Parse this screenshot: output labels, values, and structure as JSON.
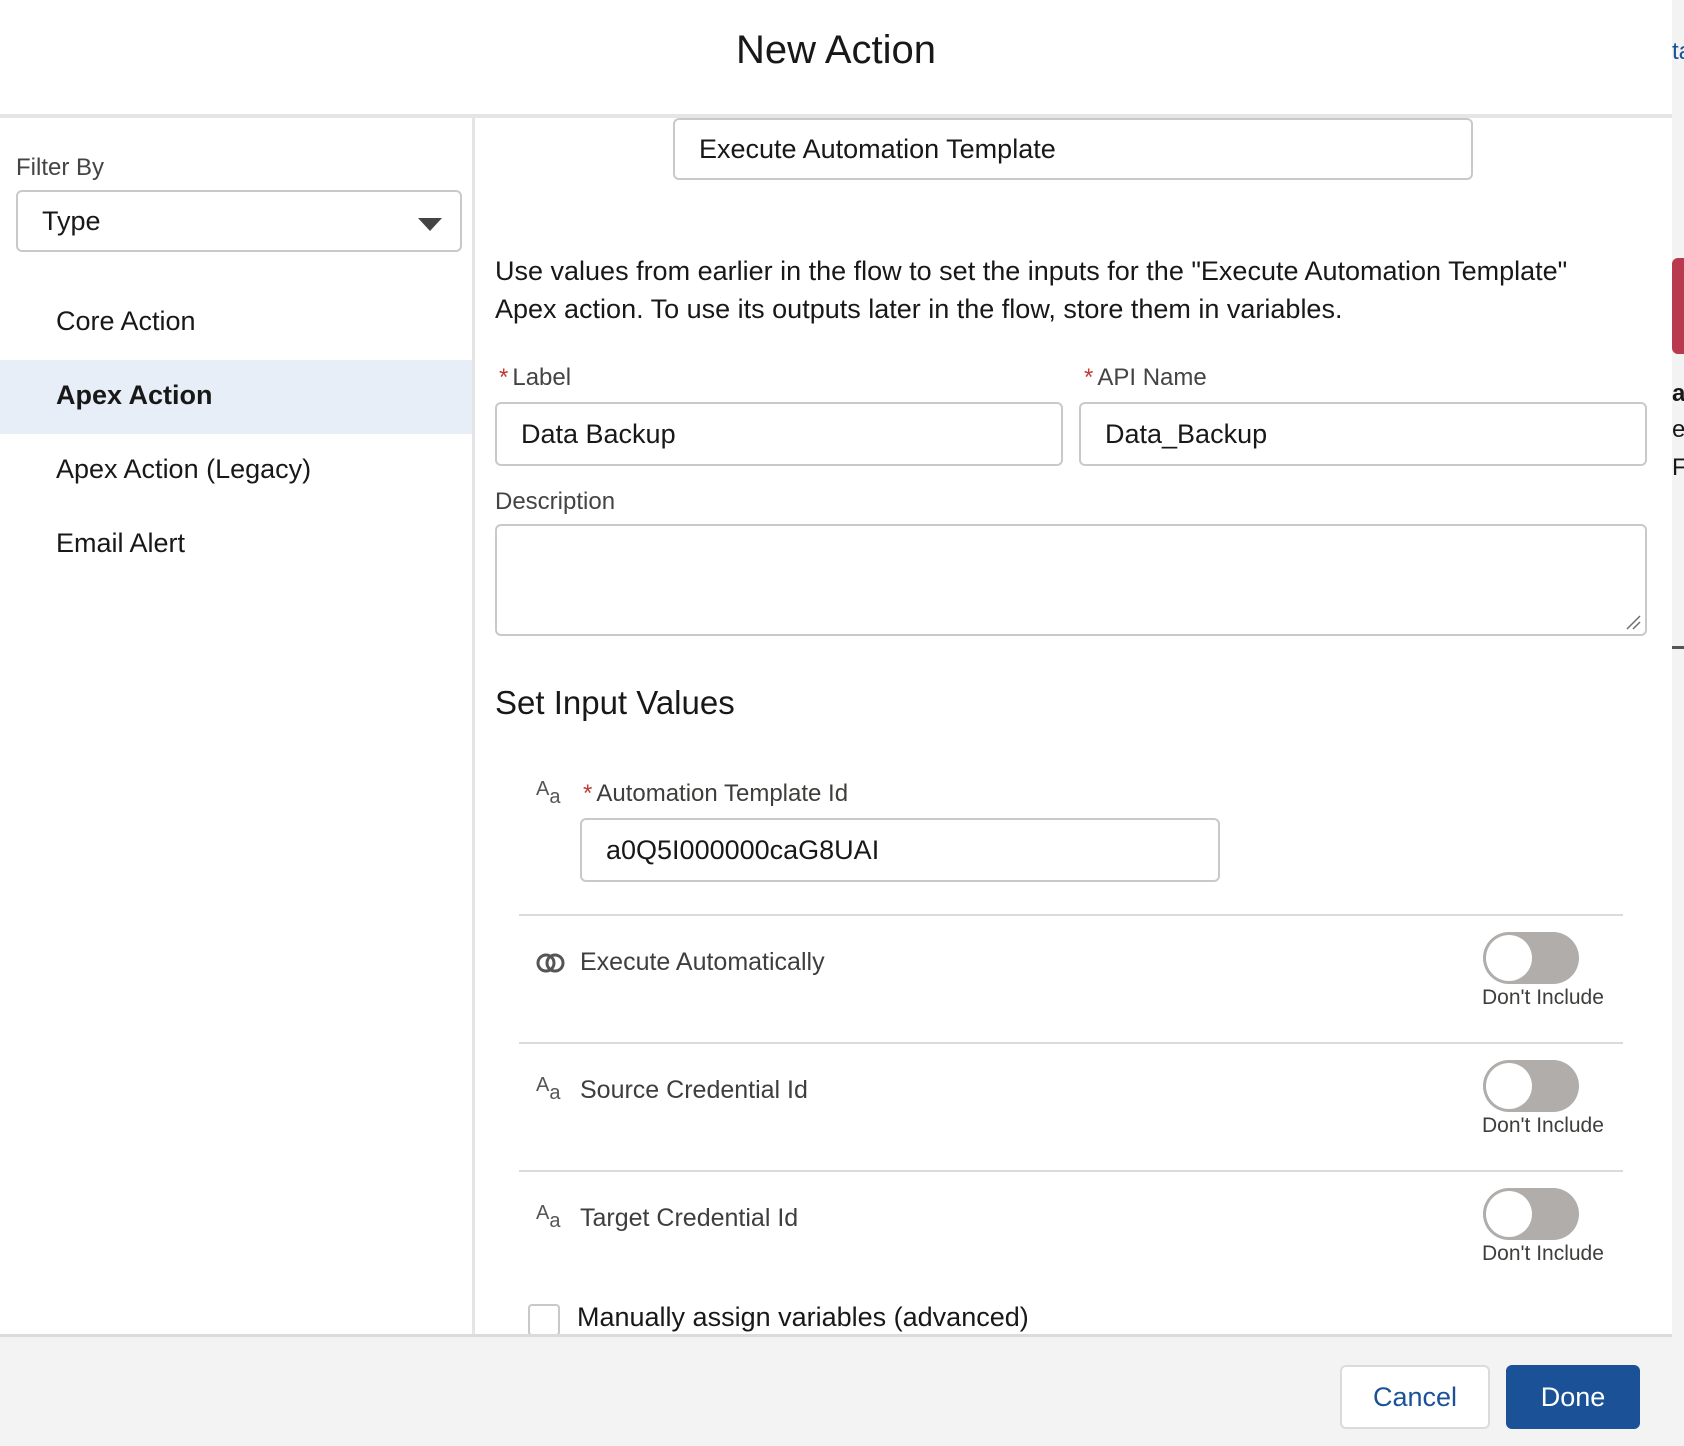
{
  "modal": {
    "title": "New Action",
    "cancel_label": "Cancel",
    "done_label": "Done"
  },
  "sidebar": {
    "filter_label": "Filter By",
    "filter_value": "Type",
    "items": [
      {
        "label": "Core Action",
        "active": false
      },
      {
        "label": "Apex Action",
        "active": true
      },
      {
        "label": "Apex Action (Legacy)",
        "active": false
      },
      {
        "label": "Email Alert",
        "active": false
      }
    ]
  },
  "main": {
    "selected_action": "Execute Automation Template",
    "intro_text": "Use values from earlier in the flow to set the inputs for the \"Execute Automation Template\" Apex action. To use its outputs later in the flow, store them in variables.",
    "label_field": {
      "label": "Label",
      "required_mark": "*",
      "value": "Data Backup"
    },
    "api_name_field": {
      "label": "API Name",
      "required_mark": "*",
      "value": "Data_Backup"
    },
    "description_field": {
      "label": "Description",
      "value": ""
    },
    "section_title": "Set Input Values",
    "inputs": {
      "template_id": {
        "label": "Automation Template Id",
        "required_mark": "*",
        "value": "a0Q5I000000caG8UAI",
        "icon": "text-type-icon"
      },
      "execute_automatically": {
        "label": "Execute Automatically",
        "toggle_label": "Don't Include",
        "toggled": false,
        "icon": "boolean-type-icon"
      },
      "source_credential": {
        "label": "Source Credential Id",
        "toggle_label": "Don't Include",
        "toggled": false,
        "icon": "text-type-icon"
      },
      "target_credential": {
        "label": "Target Credential Id",
        "toggle_label": "Don't Include",
        "toggled": false,
        "icon": "text-type-icon"
      }
    },
    "manual_assign_label": "Manually assign variables (advanced)",
    "manual_assign_checked": false
  },
  "background": {
    "fragments": [
      "ta",
      "a",
      "e",
      "F"
    ]
  },
  "colors": {
    "brand_button": "#1b5297",
    "active_item_bg": "#e8eef8",
    "required": "#c23934",
    "toggle_off": "#b0adab"
  }
}
